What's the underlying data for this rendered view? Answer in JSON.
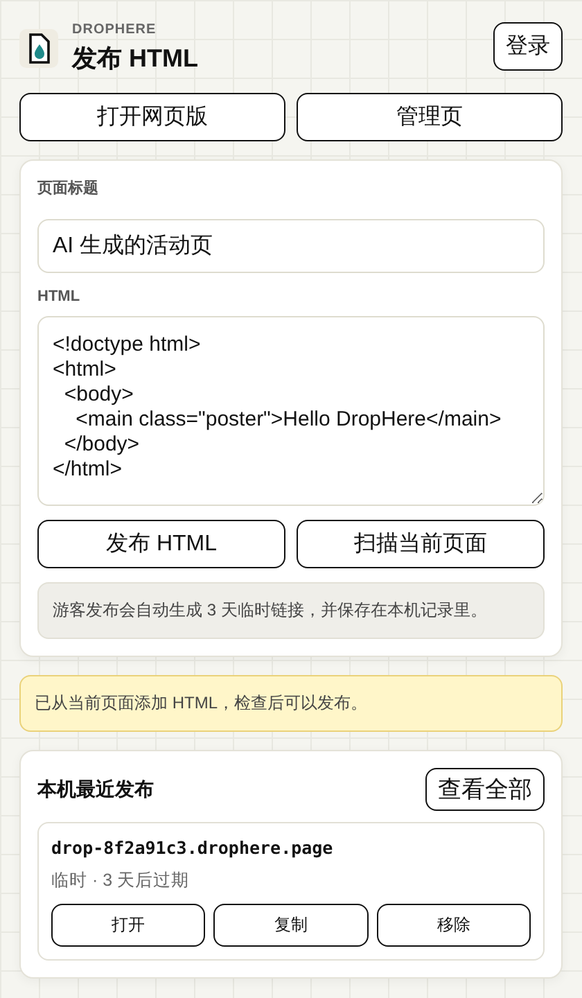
{
  "header": {
    "brand": "DROPHERE",
    "title": "发布 HTML",
    "login": "登录"
  },
  "nav_buttons": [
    "打开网页版",
    "管理页"
  ],
  "form": {
    "title_label": "页面标题",
    "title_value": "AI 生成的活动页",
    "html_label": "HTML",
    "html_value": "<!doctype html>\n<html>\n  <body>\n    <main class=\"poster\">Hello DropHere</main>\n  </body>\n</html>",
    "buttons": [
      "发布 HTML",
      "扫描当前页面"
    ],
    "hint": "游客发布会自动生成 3 天临时链接，并保存在本机记录里。"
  },
  "notice": "已从当前页面添加 HTML，检查后可以发布。",
  "recent": {
    "title": "本机最近发布",
    "view_all": "查看全部",
    "items": [
      {
        "url": "drop-8f2a91c3.drophere.page",
        "meta": "临时 · 3 天后过期",
        "actions": [
          "打开",
          "复制",
          "移除"
        ]
      }
    ]
  }
}
